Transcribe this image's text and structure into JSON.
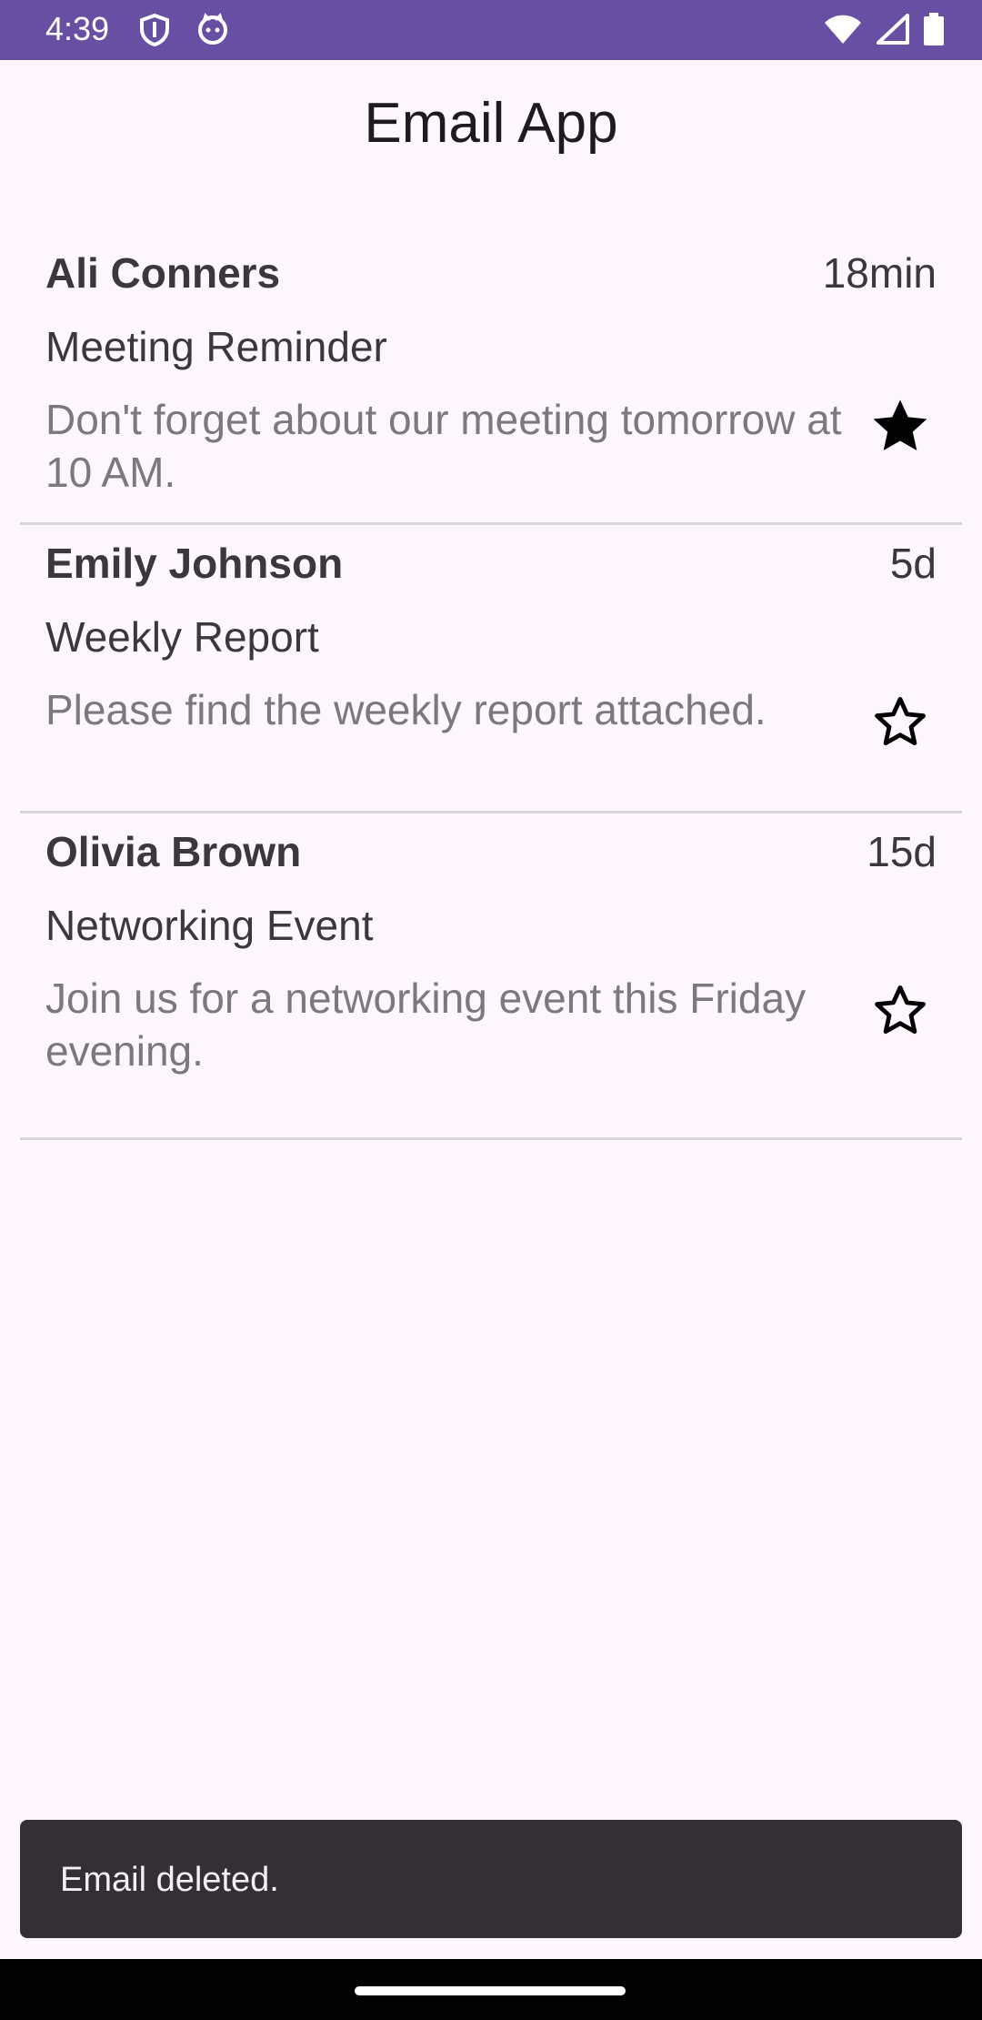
{
  "status_bar": {
    "time": "4:39",
    "left_icons": [
      "shield-icon",
      "cat-icon"
    ],
    "right_icons": [
      "wifi-icon",
      "signal-icon",
      "battery-icon"
    ]
  },
  "app": {
    "title": "Email App"
  },
  "emails": [
    {
      "sender": "Ali Conners",
      "time": "18min",
      "subject": "Meeting Reminder",
      "preview": "Don't forget about our meeting tomorrow at 10 AM.",
      "starred": true
    },
    {
      "sender": "Emily Johnson",
      "time": "5d",
      "subject": "Weekly Report",
      "preview": "Please find the weekly report attached.",
      "starred": false
    },
    {
      "sender": "Olivia Brown",
      "time": "15d",
      "subject": "Networking Event",
      "preview": "Join us for a networking event this Friday evening.",
      "starred": false
    }
  ],
  "snackbar": {
    "message": "Email deleted."
  },
  "colors": {
    "status_bar": "#6750a4",
    "background": "#fdf7fd",
    "snackbar": "#322f35"
  }
}
